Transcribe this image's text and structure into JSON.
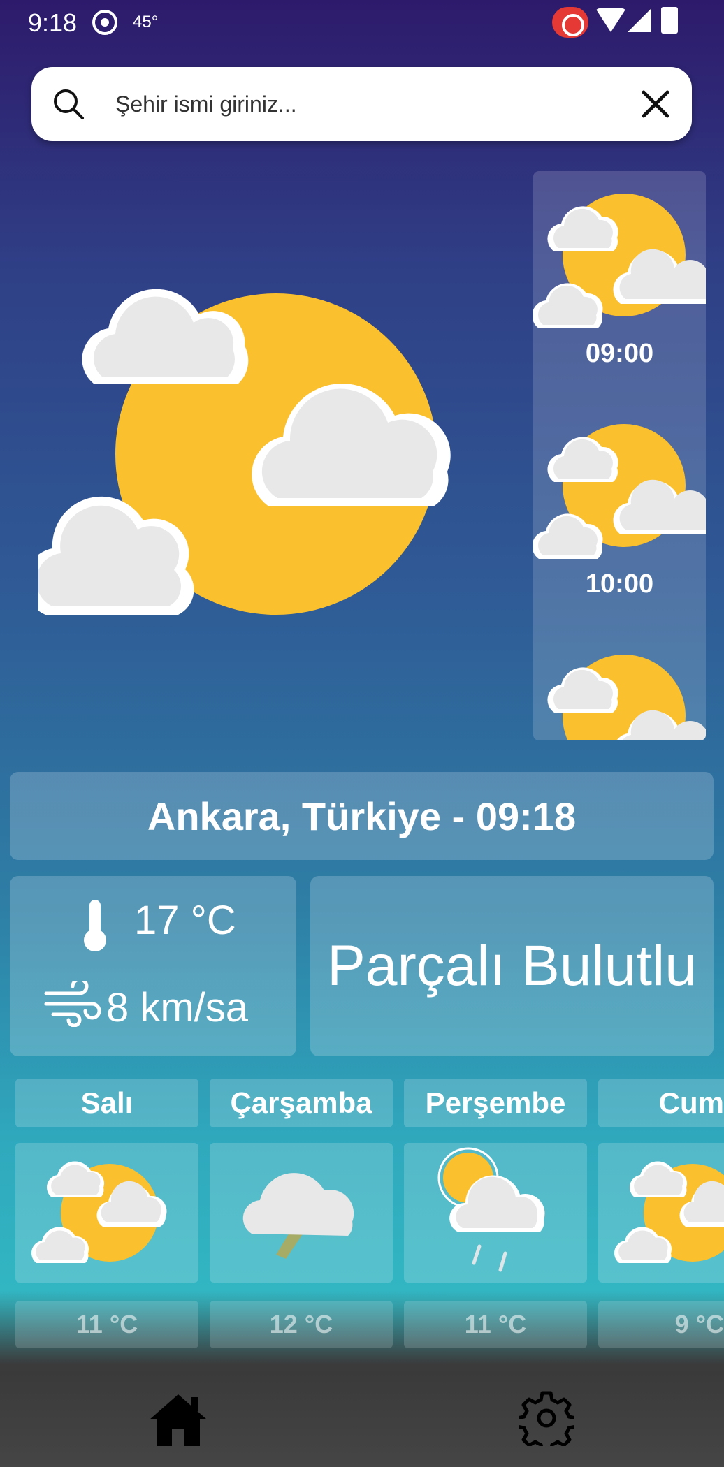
{
  "status_bar": {
    "time": "9:18",
    "temp_indicator": "45°"
  },
  "search": {
    "placeholder": "Şehir ismi giriniz...",
    "search_icon": "search-icon",
    "clear_icon": "close-icon"
  },
  "current": {
    "icon": "partly-cloudy-icon",
    "location": "Ankara, Türkiye - 09:18",
    "temperature": "17 °C",
    "wind": "8 km/sa",
    "condition": "Parçalı Bulutlu"
  },
  "hourly": [
    {
      "time": "",
      "icon": "partly-cloudy-icon"
    },
    {
      "time": "09:00",
      "icon": "partly-cloudy-icon"
    },
    {
      "time": "10:00",
      "icon": "partly-cloudy-icon"
    }
  ],
  "forecast": [
    {
      "day": "Salı",
      "temp": "11 °C",
      "icon": "partly-cloudy-icon"
    },
    {
      "day": "Çarşamba",
      "temp": "12 °C",
      "icon": "thunderstorm-icon"
    },
    {
      "day": "Perşembe",
      "temp": "11 °C",
      "icon": "sun-rain-icon"
    },
    {
      "day": "Cum",
      "temp": "9 °C",
      "icon": "partly-cloudy-icon"
    }
  ],
  "nav": {
    "home_icon": "home-icon",
    "settings_icon": "gear-icon"
  },
  "colors": {
    "sun": "#FBC02D",
    "cloud": "#E8E8E8",
    "search_bg": "#FFFFFF",
    "nav_bg": "#3A3A3A"
  }
}
